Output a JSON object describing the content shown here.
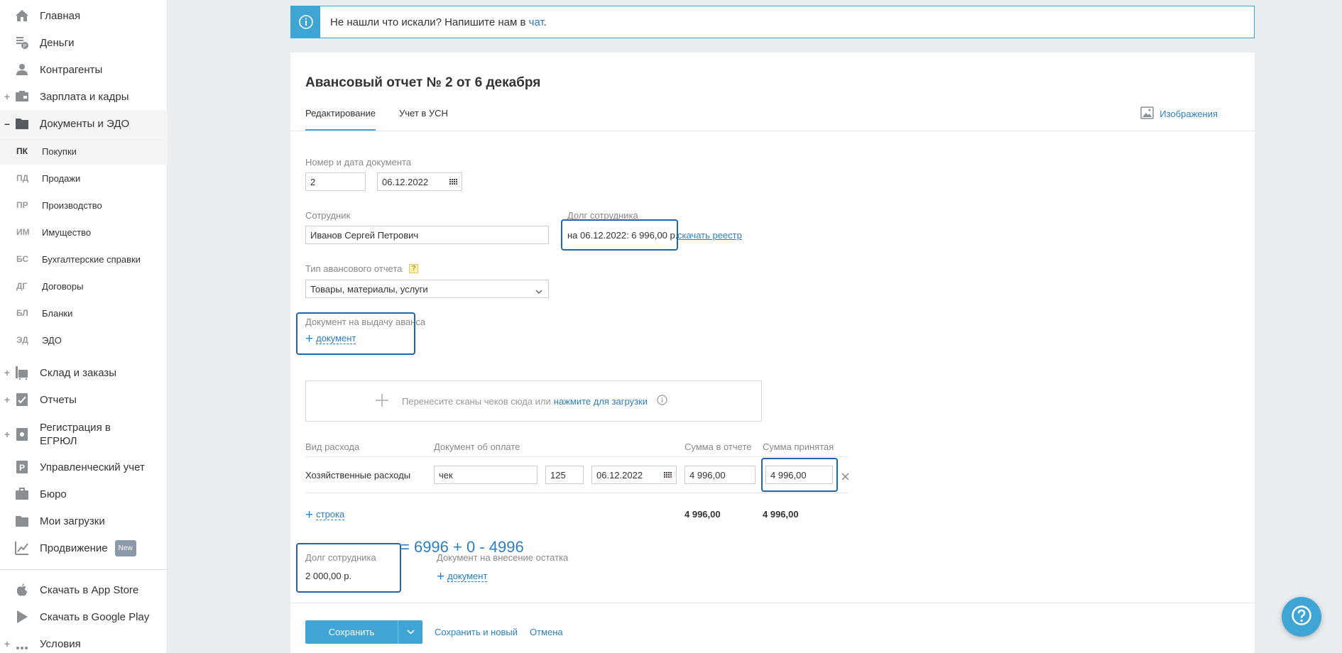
{
  "sidebar": {
    "items": [
      {
        "label": "Главная",
        "icon": "home-icon",
        "expander": ""
      },
      {
        "label": "Деньги",
        "icon": "money-icon",
        "expander": ""
      },
      {
        "label": "Контрагенты",
        "icon": "contractors-icon",
        "expander": ""
      },
      {
        "label": "Зарплата и кадры",
        "icon": "salary-icon",
        "expander": "+"
      },
      {
        "label": "Документы и ЭДО",
        "icon": "folder-icon",
        "expander": "–"
      }
    ],
    "subitems": [
      {
        "abbr": "ПК",
        "label": "Покупки"
      },
      {
        "abbr": "ПД",
        "label": "Продажи"
      },
      {
        "abbr": "ПР",
        "label": "Производство"
      },
      {
        "abbr": "ИМ",
        "label": "Имущество"
      },
      {
        "abbr": "БС",
        "label": "Бухгалтерские справки"
      },
      {
        "abbr": "ДГ",
        "label": "Договоры"
      },
      {
        "abbr": "БЛ",
        "label": "Бланки"
      },
      {
        "abbr": "ЭД",
        "label": "ЭДО"
      }
    ],
    "items2": [
      {
        "label": "Склад и заказы",
        "expander": "+"
      },
      {
        "label": "Отчеты",
        "expander": "+"
      },
      {
        "label_line1": "Регистрация в",
        "label_line2": "ЕГРЮЛ",
        "expander": "+"
      },
      {
        "label": "Управленческий учет"
      },
      {
        "label": "Бюро"
      },
      {
        "label": "Мои загрузки"
      },
      {
        "label": "Продвижение",
        "badge": "New"
      }
    ],
    "bottom": [
      {
        "label": "Скачать в App Store"
      },
      {
        "label": "Скачать в Google Play"
      },
      {
        "label": "Условия"
      }
    ]
  },
  "banner": {
    "text": "Не нашли что искали? Напишите нам в ",
    "link": "чат",
    "suffix": "."
  },
  "page": {
    "title": "Авансовый отчет № 2 от 6 декабря",
    "tabs": [
      "Редактирование",
      "Учет в УСН"
    ],
    "images_link": "Изображения"
  },
  "form": {
    "doc_number_label": "Номер и дата документа",
    "doc_number": "2",
    "doc_date": "06.12.2022",
    "employee_label": "Сотрудник",
    "employee": "Иванов Сергей Петрович",
    "debt_label": "Долг сотрудника",
    "debt_text": "на 06.12.2022: 6 996,00 р.",
    "download_registry": "скачать реестр",
    "report_type_label": "Тип авансового отчета",
    "report_type_help": "?",
    "report_type": "Товары, материалы, услуги",
    "advance_doc_label": "Документ на выдачу аванса",
    "add_document": "документ",
    "dropzone_text": "Перенесите сканы чеков сюда или ",
    "dropzone_link": "нажмите для загрузки"
  },
  "table": {
    "headers": [
      "Вид расхода",
      "Документ об оплате",
      "Сумма в отчете",
      "Сумма принятая"
    ],
    "row": {
      "expense_type": "Хозяйственные расходы",
      "doc_name": "чек",
      "doc_number": "125",
      "doc_date": "06.12.2022",
      "amount_report": "4 996,00",
      "amount_accepted": "4 996,00"
    },
    "add_row": "строка",
    "total_report": "4 996,00",
    "total_accepted": "4 996,00"
  },
  "summary": {
    "formula": "= 6996 + 0 - 4996",
    "debt_label": "Долг сотрудника",
    "debt_value": "2 000,00 р.",
    "remainder_label": "Документ на внесение остатка",
    "add_document": "документ"
  },
  "footer": {
    "save": "Сохранить",
    "save_and_new": "Сохранить и новый",
    "cancel": "Отмена"
  },
  "colors": {
    "accent": "#3fa5d4",
    "link": "#2b7fc2",
    "highlight": "#2266aa"
  }
}
